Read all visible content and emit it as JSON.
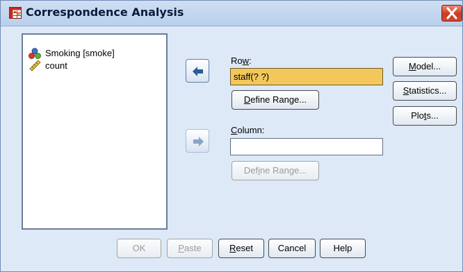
{
  "window": {
    "title": "Correspondence Analysis",
    "title_icon": "table-grid-icon",
    "close_icon": "close-x-icon"
  },
  "variables": [
    {
      "label": "Smoking [smoke]",
      "icon": "nominal-variable-icon"
    },
    {
      "label": "count",
      "icon": "scale-ruler-icon"
    }
  ],
  "row": {
    "label_pre": "Ro",
    "label_u": "w",
    "label_post": ":",
    "value": "staff(? ?)",
    "define_pre": "",
    "define_u": "D",
    "define_post": "efine Range..."
  },
  "column": {
    "label_pre": "",
    "label_u": "C",
    "label_post": "olumn:",
    "value": "",
    "define_pre": "Def",
    "define_u": "i",
    "define_post": "ne Range..."
  },
  "side_buttons": {
    "model_pre": "",
    "model_u": "M",
    "model_post": "odel...",
    "statistics_pre": "",
    "statistics_u": "S",
    "statistics_post": "tatistics...",
    "plots_pre": "Plo",
    "plots_u": "t",
    "plots_post": "s..."
  },
  "bottom_buttons": {
    "ok": "OK",
    "paste_pre": "",
    "paste_u": "P",
    "paste_post": "aste",
    "reset_pre": "",
    "reset_u": "R",
    "reset_post": "eset",
    "cancel": "Cancel",
    "help": "Help"
  },
  "colors": {
    "dialog_bg": "#dde9f7",
    "selected_field": "#f4c75a",
    "close_button": "#c93a24",
    "arrow_active": "#2d5b9a",
    "arrow_disabled": "#8aa4c4"
  }
}
